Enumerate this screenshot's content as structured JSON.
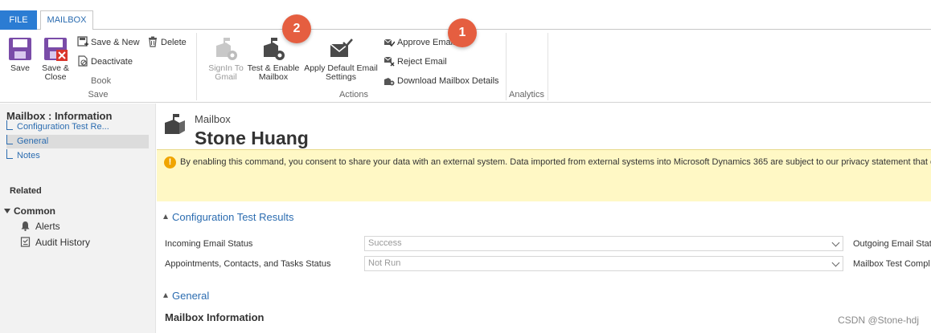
{
  "tabs": {
    "file": "FILE",
    "mailbox": "MAILBOX"
  },
  "ribbon": {
    "save_group": {
      "save": "Save",
      "save_close_line1": "Save &",
      "save_close_line2": "Close",
      "save_new": "Save & New",
      "delete": "Delete",
      "deactivate": "Deactivate",
      "book": "Book",
      "label": "Save"
    },
    "actions_group": {
      "signin_line1": "SignIn To",
      "signin_line2": "Gmail",
      "test_enable_line1": "Test & Enable",
      "test_enable_line2": "Mailbox",
      "apply_line1": "Apply Default Email",
      "apply_line2": "Settings",
      "approve_email": "Approve Email",
      "reject_email": "Reject Email",
      "download_details": "Download Mailbox Details",
      "label": "Actions"
    },
    "analytics_group": {
      "label": "Analytics"
    }
  },
  "badges": {
    "first": "1",
    "second": "2"
  },
  "leftnav": {
    "title": "Mailbox : Information",
    "subitems": [
      "Configuration Test Re...",
      "General",
      "Notes"
    ],
    "related": "Related",
    "common": "Common",
    "links": [
      "Alerts",
      "Audit History"
    ]
  },
  "main": {
    "entity_type": "Mailbox",
    "entity_name": "Stone Huang",
    "notice": "By enabling this command, you consent to share your data with an external system. Data imported from external systems into Microsoft Dynamics 365 are subject to our privacy statement that c",
    "config_section": "Configuration Test Results",
    "incoming_label": "Incoming Email Status",
    "incoming_value": "Success",
    "outgoing_label": "Outgoing Email Stat",
    "appointments_label": "Appointments, Contacts, and Tasks Status",
    "appointments_value": "Not Run",
    "mailbox_test_label": "Mailbox Test Compl",
    "general_section": "General",
    "mailbox_info": "Mailbox Information"
  },
  "watermark": "CSDN @Stone-hdj",
  "colors": {
    "accent": "#2b7cd3",
    "link": "#2b6cb0",
    "badge": "#e55e40",
    "notice_bg": "#fff8c5",
    "warn": "#f0a500"
  }
}
